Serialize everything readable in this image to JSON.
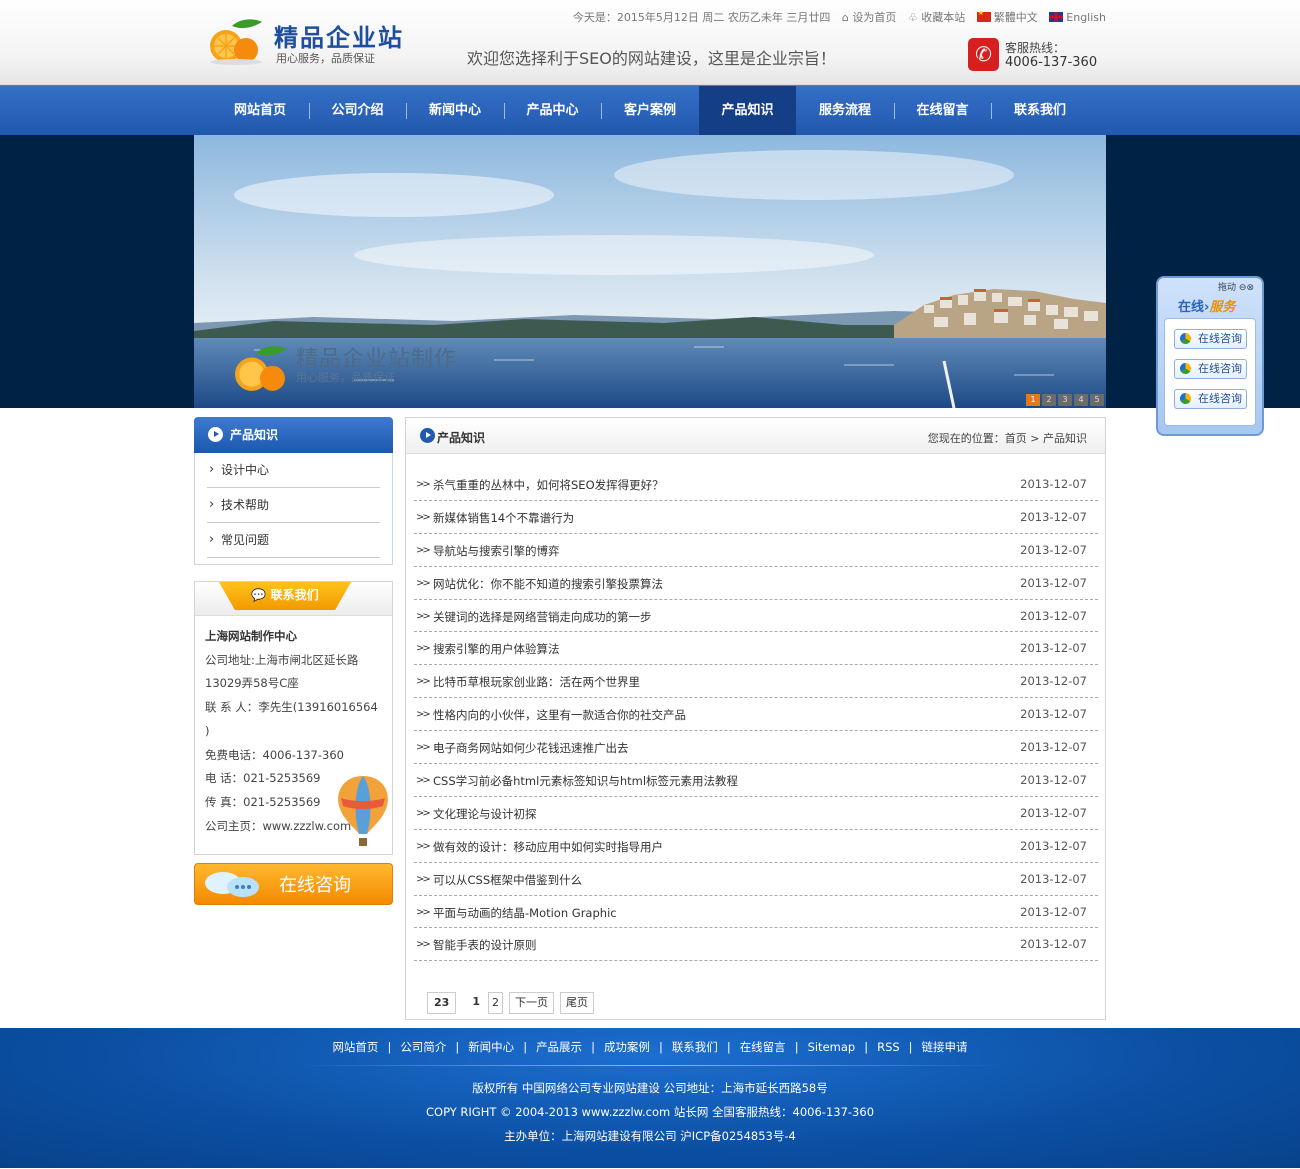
{
  "header": {
    "logo_name": "精品企业站",
    "logo_slogan": "用心服务，品质保证",
    "today_label": "今天是：",
    "date_text": "2015年5月12日  周二  农历乙未年  三月廿四",
    "set_home": "设为首页",
    "bookmark": "收藏本站",
    "lang_tw": "繁體中文",
    "lang_en": "English",
    "welcome": "欢迎您选择利于SEO的网站建设，这里是企业宗旨！",
    "hotline_label": "客服热线：",
    "hotline_number": "4006-137-360"
  },
  "nav": {
    "items": [
      "网站首页",
      "公司介绍",
      "新闻中心",
      "产品中心",
      "客户案例",
      "产品知识",
      "服务流程",
      "在线留言",
      "联系我们"
    ],
    "active_index": 5,
    "active_color": "#143f86"
  },
  "banner": {
    "title": "精品企业站制作",
    "slogan": "用心服务，品质保证",
    "slides": [
      "1",
      "2",
      "3",
      "4",
      "5"
    ],
    "active_slide": 1
  },
  "sidebar": {
    "category_title": "产品知识",
    "categories": [
      "设计中心",
      "技术帮助",
      "常见问题"
    ],
    "contact_title": "联系我们",
    "contact_lines": [
      "上海网站制作中心",
      "公司地址:上海市闸北区延长路",
      "13029弄58号C座",
      "联 系 人：李先生(13916016564 )",
      "免费电话：4006-137-360",
      "电 话：021-5253569",
      "传 真：021-5253569",
      "公司主页：www.zzzlw.com"
    ],
    "consult_label": "在线咨询"
  },
  "content": {
    "title": "产品知识",
    "breadcrumb": "您现在的位置：首页 > 产品知识",
    "articles": [
      {
        "title": "杀气重重的丛林中，如何将SEO发挥得更好？",
        "date": "2013-12-07"
      },
      {
        "title": "新媒体销售14个不靠谱行为",
        "date": "2013-12-07"
      },
      {
        "title": "导航站与搜索引擎的博弈",
        "date": "2013-12-07"
      },
      {
        "title": "网站优化：你不能不知道的搜索引擎投票算法",
        "date": "2013-12-07"
      },
      {
        "title": "关键词的选择是网络营销走向成功的第一步",
        "date": "2013-12-07"
      },
      {
        "title": "搜索引擎的用户体验算法",
        "date": "2013-12-07"
      },
      {
        "title": "比特币草根玩家创业路：活在两个世界里",
        "date": "2013-12-07"
      },
      {
        "title": "性格内向的小伙伴，这里有一款适合你的社交产品",
        "date": "2013-12-07"
      },
      {
        "title": "电子商务网站如何少花钱迅速推广出去",
        "date": "2013-12-07"
      },
      {
        "title": "CSS学习前必备html元素标签知识与html标签元素用法教程",
        "date": "2013-12-07"
      },
      {
        "title": "文化理论与设计初探",
        "date": "2013-12-07"
      },
      {
        "title": "做有效的设计：移动应用中如何实时指导用户",
        "date": "2013-12-07"
      },
      {
        "title": "可以从CSS框架中借鉴到什么",
        "date": "2013-12-07"
      },
      {
        "title": "平面与动画的结晶-Motion Graphic",
        "date": "2013-12-07"
      },
      {
        "title": "智能手表的设计原则",
        "date": "2013-12-07"
      }
    ],
    "pager": {
      "total": "23",
      "current": "1",
      "page2": "2",
      "next": "下一页",
      "last": "尾页"
    }
  },
  "float_service": {
    "drag_label": "拖动",
    "title_a": "在线",
    "title_b": "服务",
    "buttons": [
      "在线咨询",
      "在线咨询",
      "在线咨询"
    ]
  },
  "footer": {
    "links": [
      "网站首页",
      "公司简介",
      "新闻中心",
      "产品展示",
      "成功案例",
      "联系我们",
      "在线留言",
      "Sitemap",
      "RSS",
      "链接申请"
    ],
    "line1": "版权所有 中国网络公司专业网站建设 公司地址：上海市延长西路58号",
    "line2": "COPY RIGHT © 2004-2013 www.zzzlw.com 站长网 全国客服热线：4006-137-360",
    "line3": "主办单位：上海网站建设有限公司 沪ICP备0254853号-4"
  }
}
